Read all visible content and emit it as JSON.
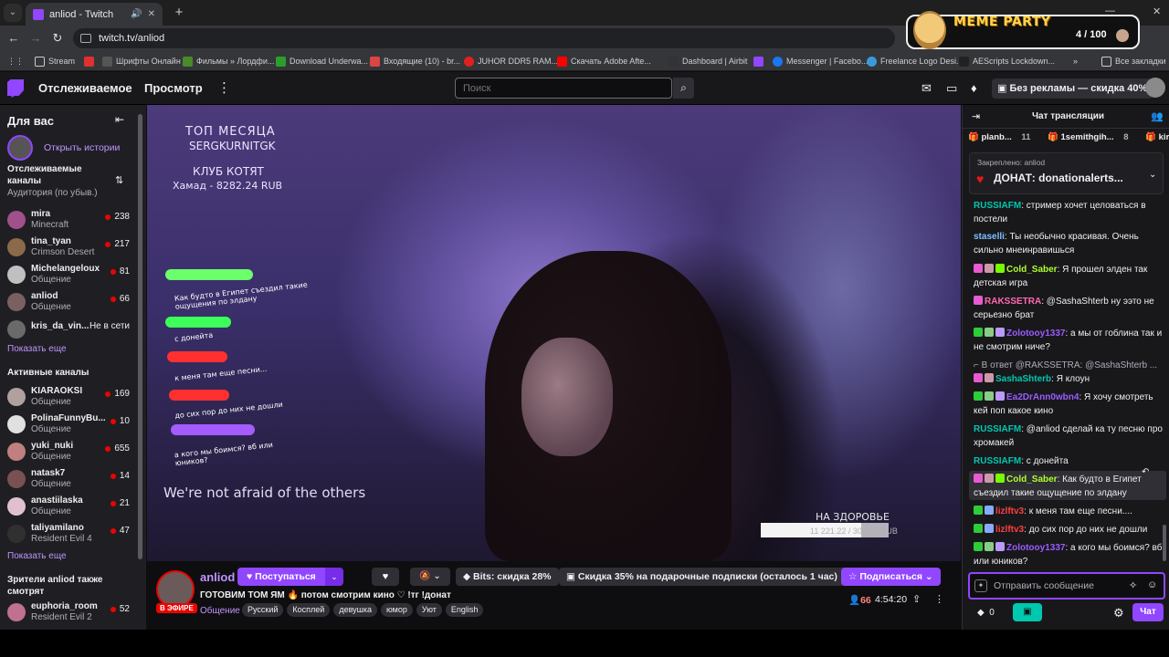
{
  "browser": {
    "tab_title": "anliod - Twitch",
    "url": "twitch.tv/anliod",
    "bookmarks": [
      "Stream",
      "Шрифты Онлайн",
      "Фильмы » Лордфи...",
      "Download Underwa...",
      "Входящие (10) - br...",
      "JUHOR DDR5 RAM...",
      "Скачать Adobe Afte...",
      "Dashboard | Airbit",
      "Messenger | Facebo...",
      "Freelance Logo Desi...",
      "AEScripts Lockdown...",
      "Все закладки"
    ]
  },
  "meme_widget": {
    "title": "MEME PARTY",
    "counter": "4 / 100"
  },
  "topnav": {
    "following": "Отслеживаемое",
    "browse": "Просмотр",
    "search_placeholder": "Поиск",
    "no_ads": "Без рекламы — скидка 40%"
  },
  "sidebar": {
    "title": "Для вас",
    "stories_label": "Открыть истории",
    "followed_title": "Отслеживаемые каналы",
    "followed_sub": "Аудитория (по убыв.)",
    "followed": [
      {
        "name": "mira",
        "game": "Minecraft",
        "viewers": "238",
        "color": "#a0508a"
      },
      {
        "name": "tina_tyan",
        "game": "Crimson Desert",
        "viewers": "217",
        "color": "#8a6a4a"
      },
      {
        "name": "Michelangeloux",
        "game": "Общение",
        "viewers": "81",
        "color": "#c0c0c0"
      },
      {
        "name": "anliod",
        "game": "Общение",
        "viewers": "66",
        "color": "#7a6060"
      },
      {
        "name": "kris_da_vin...",
        "game": "",
        "viewers": "",
        "status": "Не в сети",
        "color": "#6a6a6a"
      }
    ],
    "show_more_1": "Показать еще",
    "active_title": "Активные каналы",
    "active": [
      {
        "name": "KIARAOKSI",
        "game": "Общение",
        "viewers": "169",
        "color": "#b0a0a0"
      },
      {
        "name": "PolinaFunnyBu...",
        "game": "Общение",
        "viewers": "10",
        "color": "#e0e0e0"
      },
      {
        "name": "yuki_nuki",
        "game": "Общение",
        "viewers": "655",
        "color": "#c08080"
      },
      {
        "name": "natask7",
        "game": "Общение",
        "viewers": "14",
        "color": "#7a5050"
      },
      {
        "name": "anastiilaska",
        "game": "Общение",
        "viewers": "21",
        "color": "#e0c0d0"
      },
      {
        "name": "taliyamilano",
        "game": "Resident Evil 4",
        "viewers": "47",
        "color": "#303030"
      }
    ],
    "show_more_2": "Показать еще",
    "also_watch_title": "Зрители anliod также смотрят",
    "also_watch": [
      {
        "name": "euphoria_room",
        "game": "Resident Evil 2",
        "viewers": "52",
        "color": "#c07090"
      }
    ]
  },
  "video": {
    "top_month": "ТОП МЕСЯЦА",
    "top_donor": "SERGKURNITGK",
    "club": "КЛУБ КОТЯТ",
    "club_sub": "Хамад - 8282.24 RUB",
    "overlay_msgs": [
      "Как будто в Египет съездил такие ощущения по элдану",
      "с донейта",
      "к меня там еще песни...",
      "до сих пор до них не дошли",
      "а кого мы боимся? вб или юников?"
    ],
    "slogan": "We're not afraid of the others",
    "goal_title": "НА ЗДОРОВЬЕ",
    "goal_text": "11 221.22 / 30 000 RUB"
  },
  "stream_info": {
    "live_label": "В ЭФИРЕ",
    "streamer": "anliod",
    "follow": "Поступаться",
    "bits_offer": "Bits: скидка 28%",
    "gift_offer": "Скидка 35% на подарочные подписки (осталось 1 час)",
    "subscribe": "Подписаться",
    "title": "ГОТОВИМ ТОМ ЯМ 🔥 потом смотрим кино ♡ !тг !донат",
    "category": "Общение",
    "tags": [
      "Русский",
      "Косплей",
      "девушка",
      "юмор",
      "Уют",
      "English"
    ],
    "viewers": "66",
    "uptime": "4:54:20"
  },
  "chat": {
    "title": "Чат трансляции",
    "gifters": [
      {
        "name": "planb...",
        "count": "11"
      },
      {
        "name": "1semithgih...",
        "count": "8"
      },
      {
        "name": "kirli",
        "count": ""
      }
    ],
    "pinned_label": "Закреплено: anliod",
    "pinned_text": "ДОНАТ: donationalerts...",
    "messages": [
      {
        "user": "RUSSIAFM",
        "color": "#00c8af",
        "text": "стример хочет целоваться в постели"
      },
      {
        "user": "staselli",
        "color": "#7fbfff",
        "text": "Ты необычно красивая. Очень сильно мнеинравишься"
      },
      {
        "user": "Cold_Saber",
        "color": "#adff2f",
        "text": "Я прошел элден так детская игра"
      },
      {
        "user": "RAKSSETRA",
        "color": "#ff69b4",
        "text": "@SashaShterb ну ээто не серьезно брат"
      },
      {
        "user": "Zolotooy1337",
        "color": "#9a5cff",
        "text": "а мы от гоблина так и не смотрим ниче?"
      },
      {
        "user": "",
        "color": "#adadb8",
        "text": "В ответ @RAKSSETRA: @SashaShterb ..."
      },
      {
        "user": "SashaShterb",
        "color": "#00c8af",
        "text": "Я клоун"
      },
      {
        "user": "Ea2DrAnn0wbn4",
        "color": "#9a5cff",
        "text": "Я хочу смотреть кей поп какое кино"
      },
      {
        "user": "RUSSIAFM",
        "color": "#00c8af",
        "text": "@anliod сделай ка ту песню про хромакей"
      },
      {
        "user": "RUSSIAFM",
        "color": "#00c8af",
        "text": "с донейта"
      },
      {
        "user": "Cold_Saber",
        "color": "#adff2f",
        "text": "Как будто в Египет съездил такие ощущение по элдану"
      },
      {
        "user": "lizlftv3",
        "color": "#ff4040",
        "text": "к меня там еще песни...."
      },
      {
        "user": "lizlftv3",
        "color": "#ff4040",
        "text": "до сих пор до них не дошли"
      },
      {
        "user": "Zolotooy1337",
        "color": "#9a5cff",
        "text": "а кого мы боимся? вб или юников?"
      }
    ],
    "input_placeholder": "Отправить сообщение",
    "bits_count": "0",
    "chat_button": "Чат"
  },
  "colors": {
    "accent": "#9146ff",
    "live": "#eb0400",
    "background": "#0e0e10",
    "panel": "#18181b"
  }
}
